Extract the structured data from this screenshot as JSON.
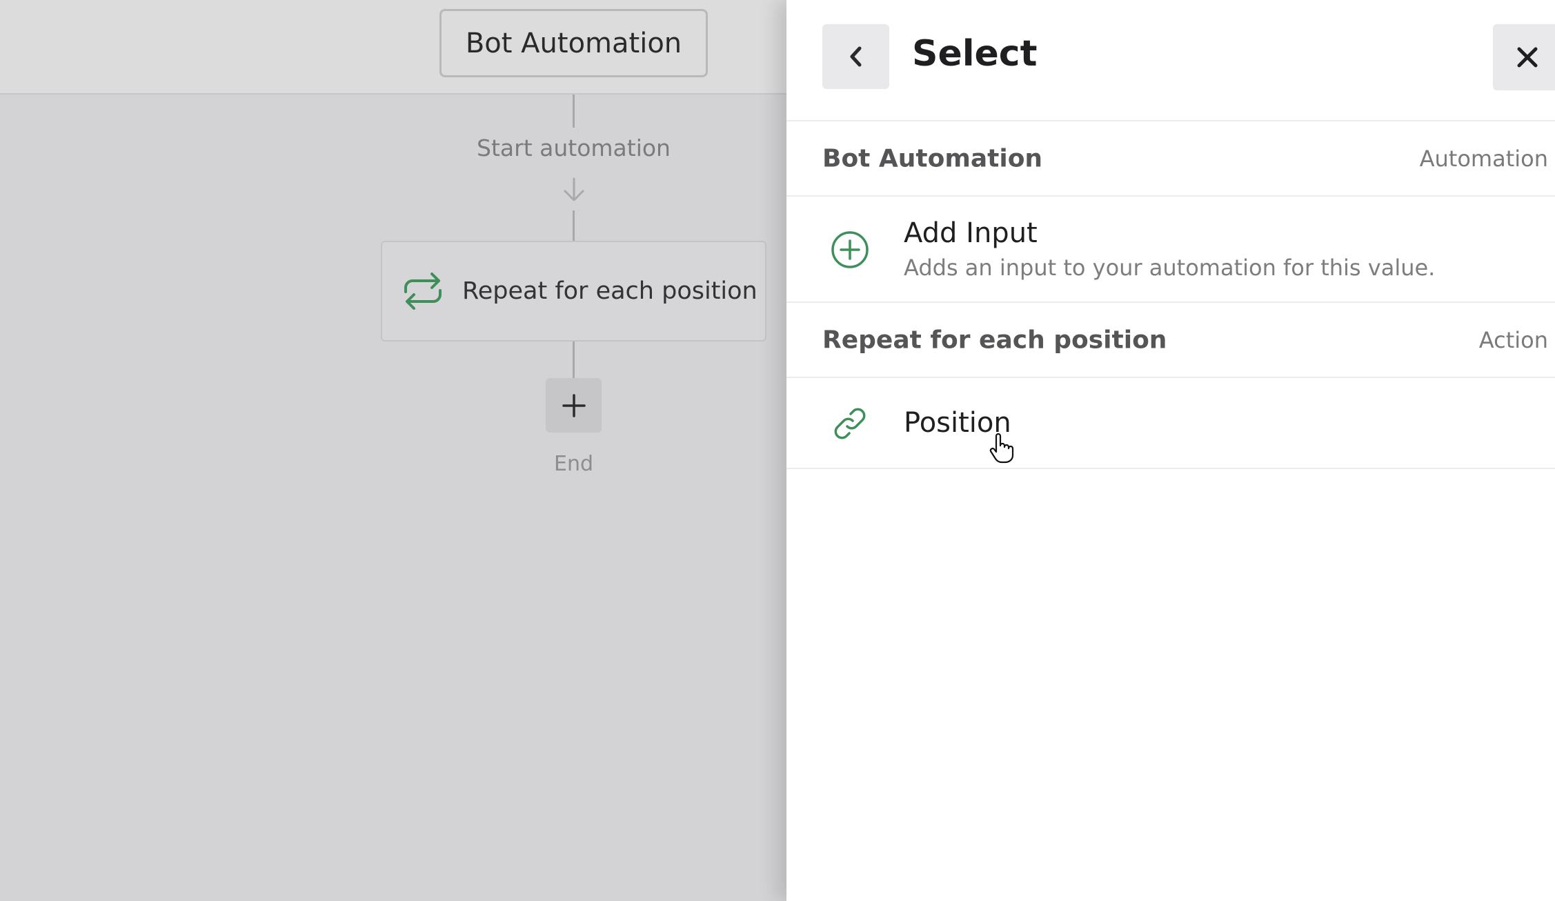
{
  "canvas": {
    "title": "Bot Automation",
    "start_label": "Start automation",
    "repeat_card_label": "Repeat for each position",
    "end_label": "End"
  },
  "panel": {
    "title": "Select",
    "sections": [
      {
        "name": "Bot Automation",
        "type": "Automation",
        "options": [
          {
            "title": "Add Input",
            "description": "Adds an input to your automation for this value.",
            "icon": "plus-circle-icon"
          }
        ]
      },
      {
        "name": "Repeat for each position",
        "type": "Action",
        "options": [
          {
            "title": "Position",
            "icon": "link-icon"
          }
        ]
      }
    ]
  },
  "colors": {
    "accent_green": "#3f8f5a",
    "canvas_bg": "#d3d3d5",
    "panel_bg": "#ffffff"
  }
}
